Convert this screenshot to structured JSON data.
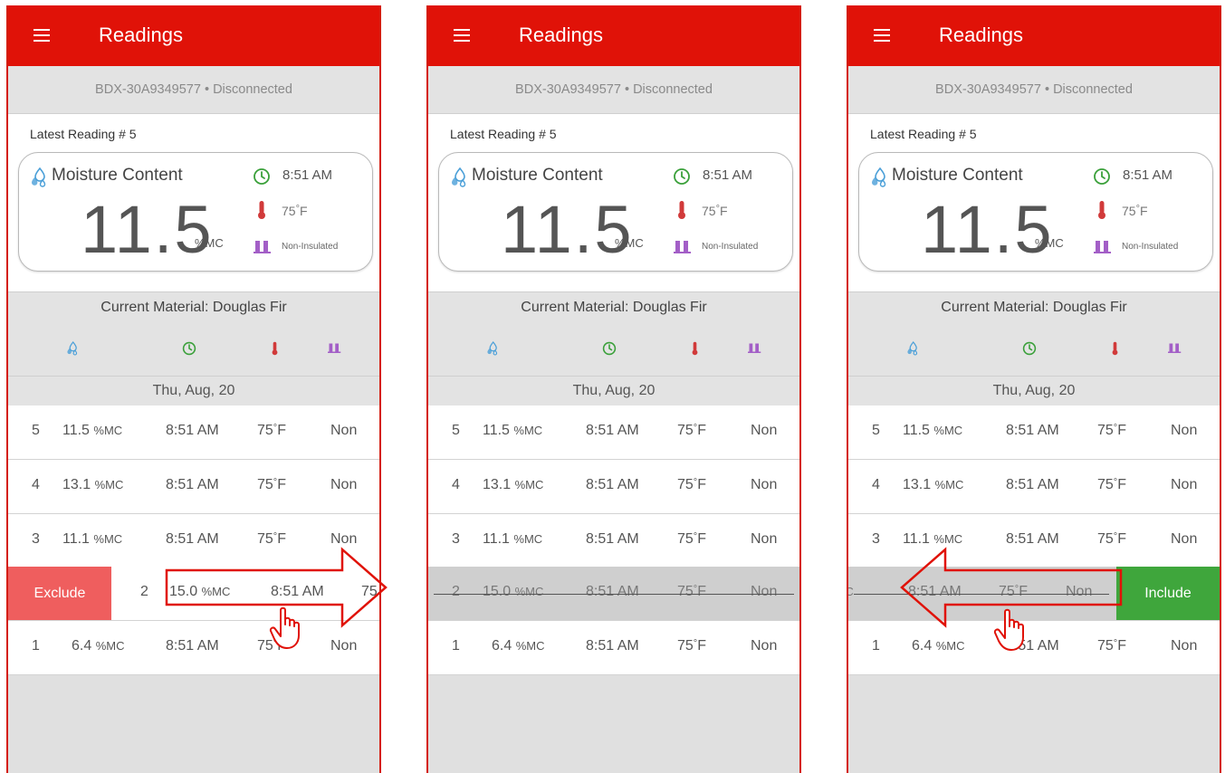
{
  "app": {
    "title": "Readings",
    "device_status": "BDX-30A9349577 • Disconnected"
  },
  "latest": {
    "label": "Latest Reading # 5",
    "metric_name": "Moisture Content",
    "value": "11.5",
    "unit": "%MC",
    "time": "8:51 AM",
    "temperature": "75",
    "temperature_unit": "F",
    "insulation": "Non-Insulated"
  },
  "material": "Current Material: Douglas Fir",
  "date_header": "Thu, Aug, 20",
  "unit_mc": "%MC",
  "temp_unit": "F",
  "actions": {
    "exclude": "Exclude",
    "include": "Include"
  },
  "readings": [
    {
      "num": "5",
      "value": "11.5",
      "time": "8:51 AM",
      "temp": "75",
      "insulation": "Non",
      "excluded": false
    },
    {
      "num": "4",
      "value": "13.1",
      "time": "8:51 AM",
      "temp": "75",
      "insulation": "Non",
      "excluded": false
    },
    {
      "num": "3",
      "value": "11.1",
      "time": "8:51 AM",
      "temp": "75",
      "insulation": "Non",
      "excluded": false
    },
    {
      "num": "2",
      "value": "15.0",
      "time": "8:51 AM",
      "temp": "75",
      "insulation": "Non",
      "excluded": true
    },
    {
      "num": "1",
      "value": "6.4",
      "time": "8:51 AM",
      "temp": "75",
      "insulation": "Non",
      "excluded": false
    }
  ],
  "colors": {
    "appbar": "#e01208",
    "exclude": "#ef5e5e",
    "include": "#3fa63c",
    "drops_icon": "#4a9fd8",
    "clock_icon": "#3aa03a",
    "thermo_icon": "#d13a3a",
    "pins_icon": "#a35fc7",
    "annotation": "#e01208"
  },
  "icons": [
    "menu-icon",
    "water-drops-icon",
    "clock-icon",
    "thermometer-icon",
    "pins-icon",
    "swipe-right-arrow-icon",
    "swipe-left-arrow-icon",
    "hand-pointer-icon"
  ]
}
